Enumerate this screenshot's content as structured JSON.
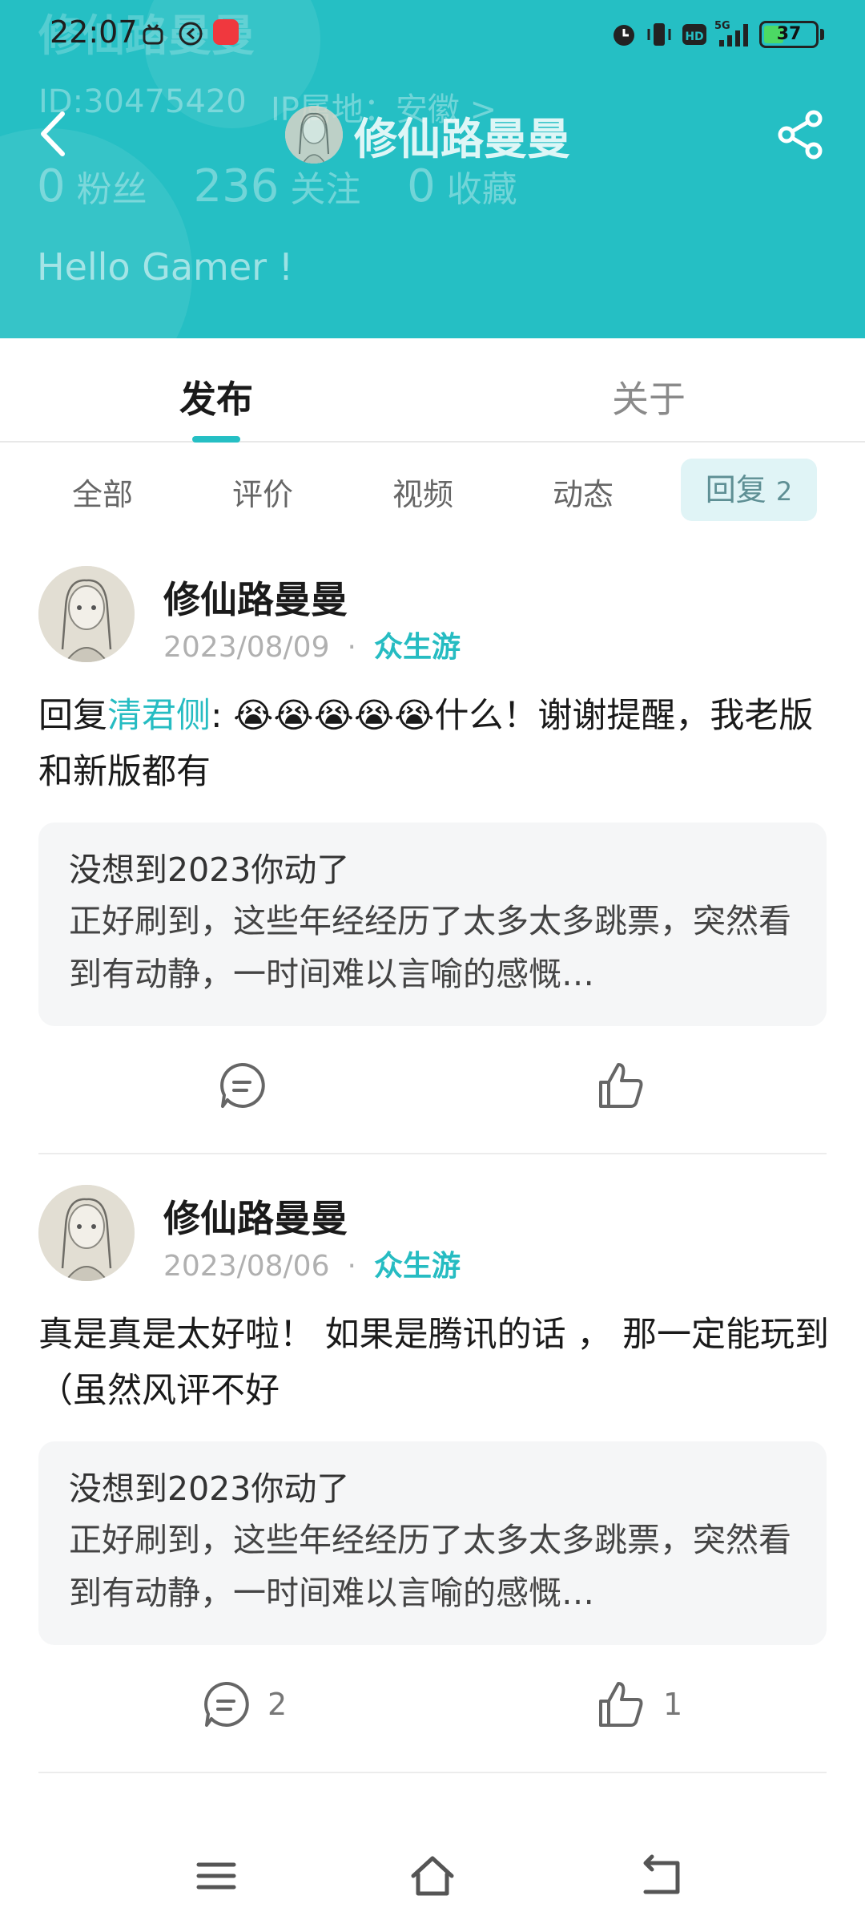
{
  "status_bar": {
    "time": "22:07",
    "battery": "37",
    "icons": [
      "alarm-icon",
      "vibrate-icon",
      "hd-icon",
      "5g-signal-icon",
      "battery-icon"
    ]
  },
  "header": {
    "bg_color": "#25bfc4",
    "title": "修仙路曼曼",
    "ghost_name": "修仙路曼曼",
    "user_id": "ID:30475420",
    "ip_location": "IP属地：安徽 >",
    "stats": [
      {
        "num": "0",
        "label": "粉丝"
      },
      {
        "num": "236",
        "label": "关注"
      },
      {
        "num": "0",
        "label": "收藏"
      }
    ],
    "bio": "Hello Gamer !"
  },
  "tabs": {
    "items": [
      {
        "label": "发布",
        "active": true
      },
      {
        "label": "关于",
        "active": false
      }
    ],
    "accent": "#25bfc4"
  },
  "filters": {
    "items": [
      "全部",
      "评价",
      "视频",
      "动态"
    ],
    "reply_label": "回复",
    "reply_count": "2"
  },
  "posts": [
    {
      "author": "修仙路曼曼",
      "date": "2023/08/09",
      "separator": "·",
      "source": "众生游",
      "reply_prefix": "回复",
      "mention": "清君侧",
      "mention_suffix": ":",
      "emoji": "😭😭😭😭😭",
      "text": "什么！谢谢提醒，我老版和新版都有",
      "quote_title": "没想到2023你动了",
      "quote_body": "正好刷到，这些年经经历了太多太多跳票，突然看到有动静，一时间难以言喻的感慨…",
      "comment_count": "",
      "like_count": ""
    },
    {
      "author": "修仙路曼曼",
      "date": "2023/08/06",
      "separator": "·",
      "source": "众生游",
      "text": "真是真是太好啦！ 如果是腾讯的话 ， 那一定能玩到（虽然风评不好",
      "quote_title": "没想到2023你动了",
      "quote_body": "正好刷到，这些年经经历了太多太多跳票，突然看到有动静，一时间难以言喻的感慨…",
      "comment_count": "2",
      "like_count": "1"
    }
  ],
  "navbar": {
    "icons": [
      "menu-icon",
      "home-icon",
      "back-icon"
    ]
  }
}
